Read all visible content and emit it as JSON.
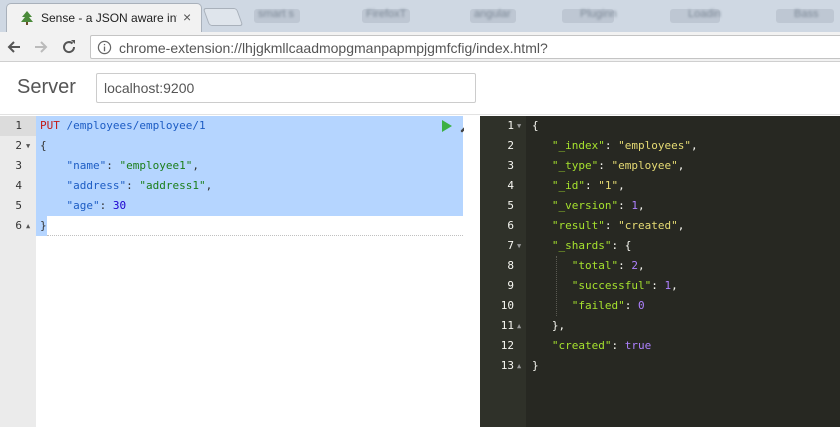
{
  "browser": {
    "tab_title": "Sense - a JSON aware int",
    "tab_close": "×",
    "other_tabs": [
      "smart s",
      "FirefoxT",
      "angular",
      "Pluginn",
      "Loadin",
      "Bass"
    ],
    "url": "chrome-extension://lhjgkmllcaadmopgmanpapmpjgmfcfig/index.html?"
  },
  "server": {
    "label": "Server",
    "value": "localhost:9200"
  },
  "request": {
    "line_numbers": [
      "1",
      "2",
      "3",
      "4",
      "5",
      "6"
    ],
    "method": "PUT",
    "path": "/employees/employee/1",
    "open_brace": "{",
    "close_brace": "}",
    "fields": [
      {
        "key": "\"name\"",
        "sep": ": ",
        "value": "\"employee1\"",
        "tail": ","
      },
      {
        "key": "\"address\"",
        "sep": ": ",
        "value": "\"address1\"",
        "tail": ","
      },
      {
        "key": "\"age\"",
        "sep": ": ",
        "value": "30",
        "tail": ""
      }
    ]
  },
  "response": {
    "line_numbers": [
      "1",
      "2",
      "3",
      "4",
      "5",
      "6",
      "7",
      "8",
      "9",
      "10",
      "11",
      "12",
      "13"
    ],
    "lines": [
      {
        "key": "",
        "sep": "",
        "value": "",
        "text": "{"
      },
      {
        "key": "\"_index\"",
        "sep": ": ",
        "value": "\"employees\"",
        "tail": ","
      },
      {
        "key": "\"_type\"",
        "sep": ": ",
        "value": "\"employee\"",
        "tail": ","
      },
      {
        "key": "\"_id\"",
        "sep": ": ",
        "value": "\"1\"",
        "tail": ","
      },
      {
        "key": "\"_version\"",
        "sep": ": ",
        "value": "1",
        "tail": ","
      },
      {
        "key": "\"result\"",
        "sep": ": ",
        "value": "\"created\"",
        "tail": ","
      },
      {
        "key": "\"_shards\"",
        "sep": ": ",
        "value": "",
        "tail": "{"
      },
      {
        "key": "\"total\"",
        "sep": ": ",
        "value": "2",
        "tail": ","
      },
      {
        "key": "\"successful\"",
        "sep": ": ",
        "value": "1",
        "tail": ","
      },
      {
        "key": "\"failed\"",
        "sep": ": ",
        "value": "0",
        "tail": ""
      },
      {
        "key": "",
        "sep": "",
        "value": "",
        "text": "},"
      },
      {
        "key": "\"created\"",
        "sep": ": ",
        "value": "true",
        "tail": ""
      },
      {
        "key": "",
        "sep": "",
        "value": "",
        "text": "}"
      }
    ]
  },
  "colors": {
    "selection": "#b5d5ff",
    "dark_bg": "#272822",
    "run_green": "#3cb043"
  }
}
